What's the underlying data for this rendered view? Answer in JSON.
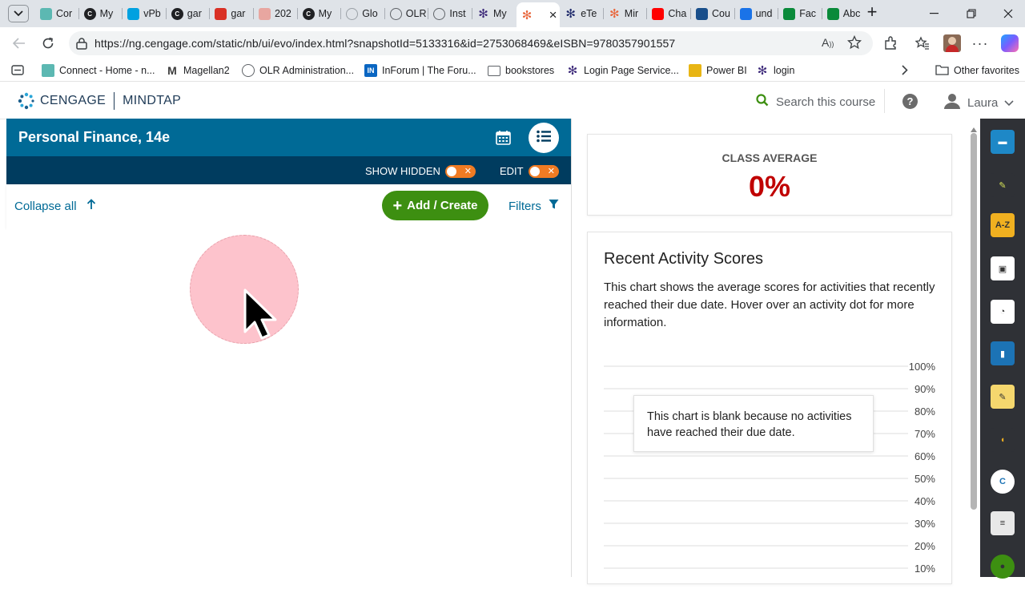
{
  "browser": {
    "tabs": [
      {
        "label": "Cor",
        "fav_color": "#5cb8b2",
        "fav_icon": "layers-icon"
      },
      {
        "label": "My",
        "fav_color": "#202124",
        "fav_icon": "c-logo-icon"
      },
      {
        "label": "vPb",
        "fav_color": "#00a1e0",
        "fav_icon": "cloud-icon"
      },
      {
        "label": "gar",
        "fav_color": "#202124",
        "fav_icon": "c-logo-icon"
      },
      {
        "label": "gar",
        "fav_color": "#d93025",
        "fav_icon": "pdf-icon"
      },
      {
        "label": "202",
        "fav_color": "#e8a6a0",
        "fav_icon": "pdf-icon"
      },
      {
        "label": "My",
        "fav_color": "#202124",
        "fav_icon": "c-logo-icon"
      },
      {
        "label": "Glo",
        "fav_color": "#9aa0a6",
        "fav_icon": "globe-icon"
      },
      {
        "label": "OLR",
        "fav_color": "#5f6368",
        "fav_icon": "globe-icon"
      },
      {
        "label": "Inst",
        "fav_color": "#5f6368",
        "fav_icon": "globe-icon"
      },
      {
        "label": "My",
        "fav_color": "#3d2a7a",
        "fav_icon": "pinwheel-icon"
      },
      {
        "label": "",
        "fav_color": "#e8663c",
        "fav_icon": "pinwheel-icon"
      },
      {
        "label": "eTe",
        "fav_color": "#1f2a6b",
        "fav_icon": "pinwheel-icon"
      },
      {
        "label": "Mir",
        "fav_color": "#e8663c",
        "fav_icon": "pinwheel-icon"
      },
      {
        "label": "Cha",
        "fav_color": "#ff0000",
        "fav_icon": "youtube-icon"
      },
      {
        "label": "Cou",
        "fav_color": "#1a4f8b",
        "fav_icon": "ring-icon"
      },
      {
        "label": "und",
        "fav_color": "#1a73e8",
        "fav_icon": "search-icon"
      },
      {
        "label": "Fac",
        "fav_color": "#0a8a3a",
        "fav_icon": "und-icon"
      },
      {
        "label": "Abc",
        "fav_color": "#0a8a3a",
        "fav_icon": "und-icon"
      }
    ],
    "new_tab": "+",
    "tab_close": "×",
    "url": "https://ng.cengage.com/static/nb/ui/evo/index.html?snapshotId=5133316&id=2753068469&eISBN=9780357901557"
  },
  "favorites": [
    {
      "label": "Connect - Home - n...",
      "icon": "layers-icon",
      "color": "#5cb8b2"
    },
    {
      "label": "Magellan2",
      "icon": "m-logo-icon",
      "color": "#3c3c3c"
    },
    {
      "label": "OLR Administration...",
      "icon": "globe-icon",
      "color": "#5f6368"
    },
    {
      "label": "InForum | The Foru...",
      "icon": "in-logo-icon",
      "color": "#0a66c2"
    },
    {
      "label": "bookstores",
      "icon": "folder-icon",
      "color": "#5f6368"
    },
    {
      "label": "Login Page  Service...",
      "icon": "pinwheel-icon",
      "color": "#3d2a7a"
    },
    {
      "label": "Power BI",
      "icon": "powerbi-icon",
      "color": "#e8b514"
    },
    {
      "label": "login",
      "icon": "pinwheel-icon",
      "color": "#3d2a7a"
    }
  ],
  "other_favorites": "Other favorites",
  "mindtap": {
    "brand": "CENGAGE",
    "product": "MINDTAP",
    "search_placeholder": "Search this course",
    "user": "Laura",
    "course_title": "Personal Finance, 14e",
    "show_hidden_label": "SHOW HIDDEN",
    "edit_label": "EDIT",
    "collapse_all": "Collapse all",
    "add_create": "Add / Create",
    "filters": "Filters",
    "class_average_label": "CLASS AVERAGE",
    "class_average_value": "0%",
    "recent_title": "Recent Activity Scores",
    "recent_desc": "This chart shows the average scores for activities that recently reached their due date. Hover over an activity dot for more information.",
    "chart_blank_msg": "This chart is blank because no activities have reached their due date.",
    "accent_green": "#3d8f11",
    "accent_blue": "#006a96",
    "accent_red": "#c00000"
  },
  "chart_data": {
    "type": "line",
    "series": [],
    "ytick_labels": [
      "100%",
      "90%",
      "80%",
      "70%",
      "60%",
      "50%",
      "40%",
      "30%",
      "20%",
      "10%"
    ],
    "ylim": [
      0,
      100
    ],
    "grid": true
  },
  "dock": [
    {
      "name": "briefcase-icon",
      "color": "#1e88c7",
      "glyph": "▬"
    },
    {
      "name": "highlighter-icon",
      "color": "#2f3136",
      "glyph": "✎"
    },
    {
      "name": "dictionary-icon",
      "color": "#f0b020",
      "glyph": "A-Z"
    },
    {
      "name": "office-icon",
      "color": "#ffffff",
      "glyph": "▣"
    },
    {
      "name": "clock-icon",
      "color": "#ffffff",
      "glyph": "◔"
    },
    {
      "name": "book-icon",
      "color": "#1c73b5",
      "glyph": "▮"
    },
    {
      "name": "notes-icon",
      "color": "#f5d76e",
      "glyph": "✎"
    },
    {
      "name": "readspeaker-icon",
      "color": "#2f3136",
      "glyph": "◖"
    },
    {
      "name": "cnow-icon",
      "color": "#ffffff",
      "glyph": "C"
    },
    {
      "name": "notebook-icon",
      "color": "#e8e8e8",
      "glyph": "≡"
    },
    {
      "name": "account-icon",
      "color": "#3d8f11",
      "glyph": "●"
    }
  ]
}
